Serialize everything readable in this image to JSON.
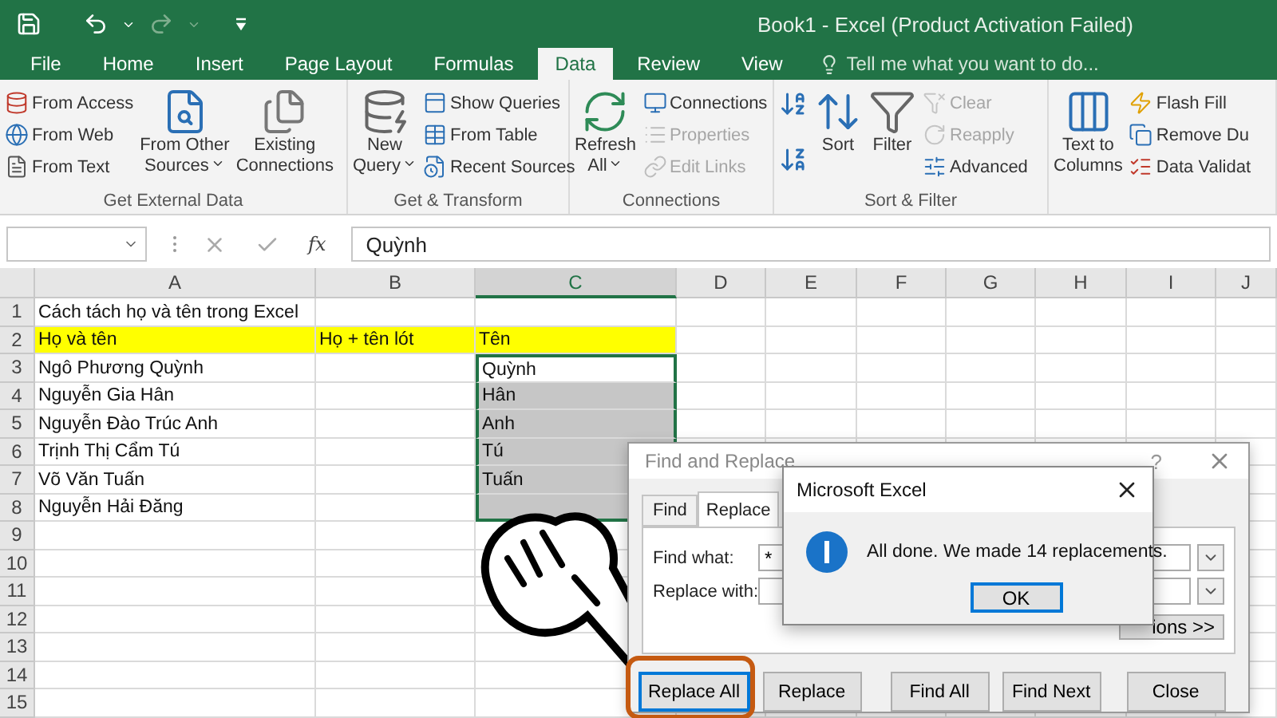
{
  "window": {
    "title": "Book1 - Excel (Product Activation Failed)"
  },
  "tabs": [
    {
      "label": "File",
      "selected": false
    },
    {
      "label": "Home",
      "selected": false
    },
    {
      "label": "Insert",
      "selected": false
    },
    {
      "label": "Page Layout",
      "selected": false
    },
    {
      "label": "Formulas",
      "selected": false
    },
    {
      "label": "Data",
      "selected": true
    },
    {
      "label": "Review",
      "selected": false
    },
    {
      "label": "View",
      "selected": false
    }
  ],
  "tell_me": {
    "placeholder": "Tell me what you want to do..."
  },
  "ribbon_groups": [
    {
      "label": "Get External Data",
      "items": [
        {
          "kind": "column",
          "entries": [
            {
              "label": "From Access",
              "disabled": false
            },
            {
              "label": "From Web",
              "disabled": false
            },
            {
              "label": "From Text",
              "disabled": false
            }
          ]
        },
        {
          "kind": "large",
          "lines": [
            "From Other",
            "Sources"
          ],
          "dropdown": true
        },
        {
          "kind": "large",
          "lines": [
            "Existing",
            "Connections"
          ],
          "dropdown": false
        }
      ]
    },
    {
      "label": "Get & Transform",
      "items": [
        {
          "kind": "large",
          "lines": [
            "New",
            "Query"
          ],
          "dropdown": true
        },
        {
          "kind": "column",
          "entries": [
            {
              "label": "Show Queries",
              "disabled": false
            },
            {
              "label": "From Table",
              "disabled": false
            },
            {
              "label": "Recent Sources",
              "disabled": false
            }
          ]
        }
      ]
    },
    {
      "label": "Connections",
      "items": [
        {
          "kind": "large",
          "lines": [
            "Refresh",
            "All"
          ],
          "dropdown": true
        },
        {
          "kind": "column",
          "entries": [
            {
              "label": "Connections",
              "disabled": false
            },
            {
              "label": "Properties",
              "disabled": true
            },
            {
              "label": "Edit Links",
              "disabled": true
            }
          ]
        }
      ]
    },
    {
      "label": "Sort & Filter",
      "items": [
        {
          "kind": "sort_pair"
        },
        {
          "kind": "large",
          "lines": [
            "Sort"
          ],
          "dropdown": false
        },
        {
          "kind": "large",
          "lines": [
            "Filter"
          ],
          "dropdown": false
        },
        {
          "kind": "column",
          "entries": [
            {
              "label": "Clear",
              "disabled": true
            },
            {
              "label": "Reapply",
              "disabled": true
            },
            {
              "label": "Advanced",
              "disabled": false
            }
          ]
        }
      ]
    },
    {
      "items": [
        {
          "kind": "large",
          "lines": [
            "Text to",
            "Columns"
          ],
          "dropdown": false
        },
        {
          "kind": "column",
          "entries": [
            {
              "label": "Flash Fill",
              "disabled": false
            },
            {
              "label": "Remove Du",
              "disabled": false
            },
            {
              "label": "Data Validat",
              "disabled": false
            }
          ]
        }
      ]
    }
  ],
  "formula_bar": {
    "function_label": "fx",
    "value": "Quỳnh"
  },
  "sheet": {
    "columns": [
      {
        "label": "A",
        "selected": false
      },
      {
        "label": "B",
        "selected": false
      },
      {
        "label": "C",
        "selected": true
      },
      {
        "label": "D",
        "selected": false
      },
      {
        "label": "E",
        "selected": false
      },
      {
        "label": "F",
        "selected": false
      },
      {
        "label": "G",
        "selected": false
      },
      {
        "label": "H",
        "selected": false
      },
      {
        "label": "I",
        "selected": false
      },
      {
        "label": "J",
        "selected": false
      }
    ],
    "rows": [
      {
        "number": "1",
        "kind": "plain",
        "cells": [
          {
            "text": "Cách tách họ và tên trong Excel",
            "selected": false
          },
          {
            "selected": false
          },
          {
            "selected": false
          }
        ]
      },
      {
        "number": "2",
        "kind": "highlighted",
        "cells": [
          {
            "text": "Họ và tên",
            "selected": false
          },
          {
            "text": "Họ + tên lót",
            "selected": false
          },
          {
            "text": "Tên",
            "selected": false
          }
        ]
      },
      {
        "number": "3",
        "kind": "plain",
        "cells": [
          {
            "text": "Ngô Phương Quỳnh",
            "selected": false
          },
          {
            "selected": false
          },
          {
            "text": "Quỳnh",
            "selected": true
          }
        ]
      },
      {
        "number": "4",
        "kind": "plain",
        "cells": [
          {
            "text": "Nguyễn Gia Hân",
            "selected": false
          },
          {
            "selected": false
          },
          {
            "text": "Hân",
            "selected": true
          }
        ]
      },
      {
        "number": "5",
        "kind": "plain",
        "cells": [
          {
            "text": "Nguyễn Đào Trúc Anh",
            "selected": false
          },
          {
            "selected": false
          },
          {
            "text": "Anh",
            "selected": true
          }
        ]
      },
      {
        "number": "6",
        "kind": "plain",
        "cells": [
          {
            "text": "Trịnh Thị Cẩm Tú",
            "selected": false
          },
          {
            "selected": false
          },
          {
            "text": "Tú",
            "selected": true
          }
        ]
      },
      {
        "number": "7",
        "kind": "plain",
        "cells": [
          {
            "text": "Võ Văn Tuấn",
            "selected": false
          },
          {
            "selected": false
          },
          {
            "text": "Tuấn",
            "selected": true
          }
        ]
      },
      {
        "number": "8",
        "kind": "plain",
        "cells": [
          {
            "text": "Nguyễn Hải Đăng",
            "selected": false
          },
          {
            "selected": false
          },
          {
            "selected": true
          }
        ]
      },
      {
        "number": "9",
        "kind": "plain"
      },
      {
        "number": "10",
        "kind": "plain"
      },
      {
        "number": "11",
        "kind": "plain"
      },
      {
        "number": "12",
        "kind": "plain"
      },
      {
        "number": "13",
        "kind": "plain"
      },
      {
        "number": "14",
        "kind": "plain"
      },
      {
        "number": "15",
        "kind": "plain"
      }
    ]
  },
  "find_replace": {
    "title": "Find and Replace",
    "help": "?",
    "tabs": [
      {
        "label": "Find",
        "selected": false
      },
      {
        "label": "Replace",
        "selected": true
      }
    ],
    "fields": [
      {
        "label": "Find what:",
        "value": "*"
      },
      {
        "label": "Replace with:"
      }
    ],
    "options_button": "ions >>",
    "buttons": [
      {
        "label": "Replace All",
        "focused": true
      },
      {
        "label": "Replace",
        "focused": false
      },
      {
        "label": "Find All",
        "focused": false
      },
      {
        "label": "Find Next",
        "focused": false
      },
      {
        "label": "Close",
        "focused": false
      }
    ]
  },
  "message_box": {
    "title": "Microsoft Excel",
    "message": "All done. We made 14 replacements.",
    "button": "OK"
  }
}
